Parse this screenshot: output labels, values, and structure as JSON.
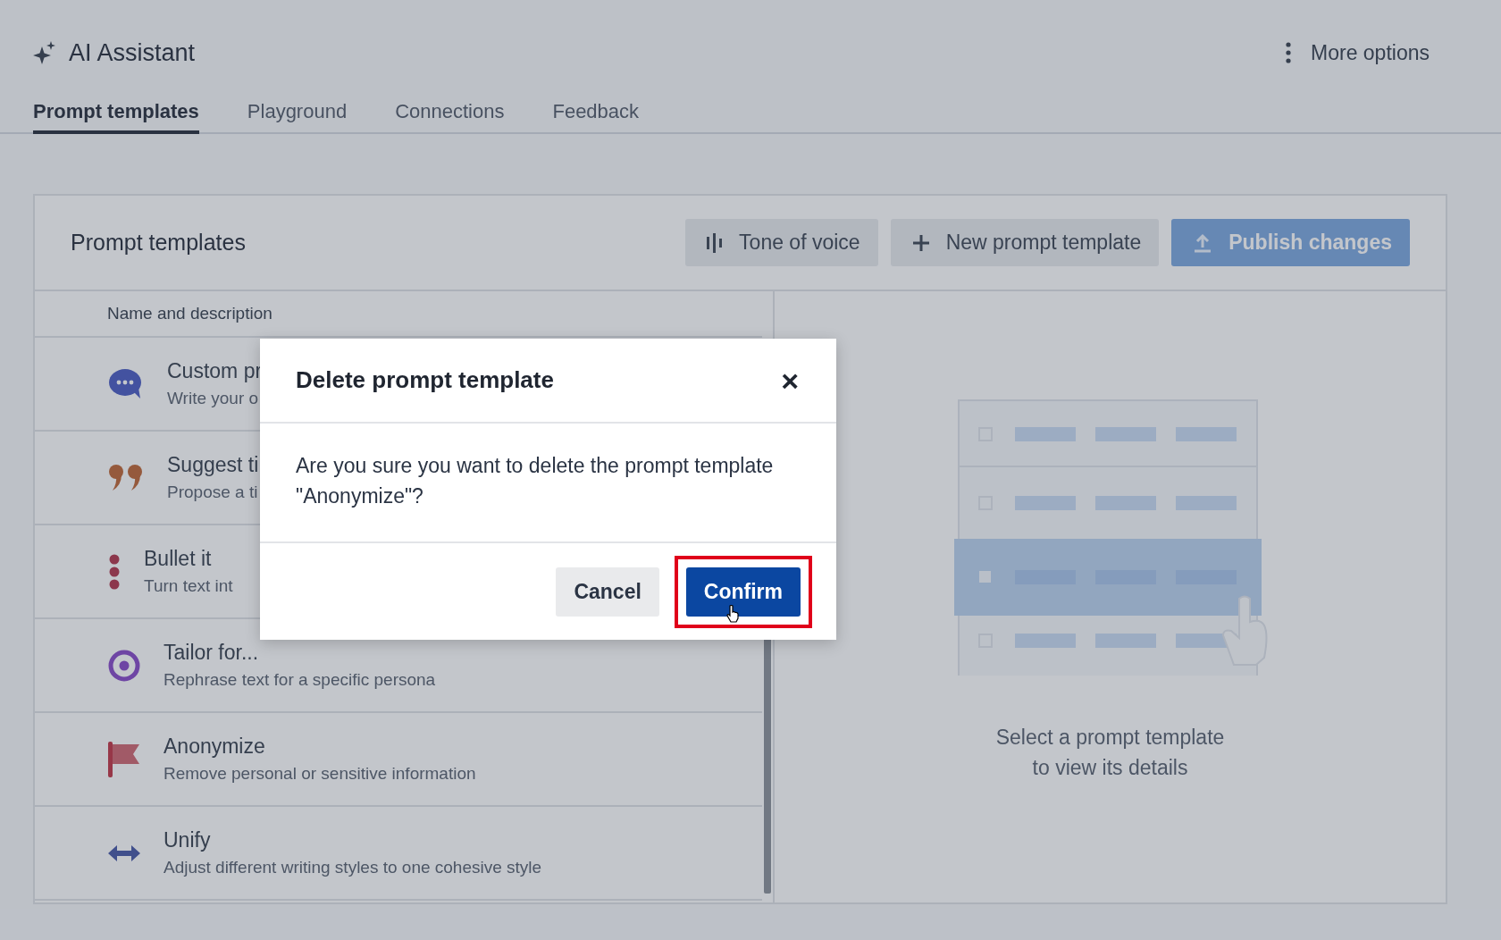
{
  "app": {
    "title": "AI Assistant",
    "more_options": "More options"
  },
  "tabs": [
    {
      "label": "Prompt templates",
      "selected": true
    },
    {
      "label": "Playground",
      "selected": false
    },
    {
      "label": "Connections",
      "selected": false
    },
    {
      "label": "Feedback",
      "selected": false
    }
  ],
  "panel": {
    "title": "Prompt templates",
    "buttons": [
      {
        "label": "Tone of voice",
        "kind": "secondary",
        "disabled": false
      },
      {
        "label": "New prompt template",
        "kind": "secondary",
        "disabled": false
      },
      {
        "label": "Publish changes",
        "kind": "primary",
        "disabled": true
      }
    ],
    "list_header": "Name and description",
    "rows": [
      {
        "name": "Custom pr",
        "description": "Write your o"
      },
      {
        "name": "Suggest ti",
        "description": "Propose a ti"
      },
      {
        "name": "Bullet it",
        "description": "Turn text int"
      },
      {
        "name": "Tailor for...",
        "description": "Rephrase text for a specific persona"
      },
      {
        "name": "Anonymize",
        "description": "Remove personal or sensitive information"
      },
      {
        "name": "Unify",
        "description": "Adjust different writing styles to one cohesive style"
      }
    ],
    "empty_state": {
      "lines": [
        "Select a prompt template",
        "to view its details"
      ]
    }
  },
  "dialog": {
    "title": "Delete prompt template",
    "close": "×",
    "message": "Are you sure you want to delete the prompt template \"Anonymize\"?",
    "buttons": [
      {
        "label": "Cancel",
        "kind": "secondary",
        "highlighted": false
      },
      {
        "label": "Confirm",
        "kind": "primary",
        "highlighted": true
      }
    ]
  }
}
